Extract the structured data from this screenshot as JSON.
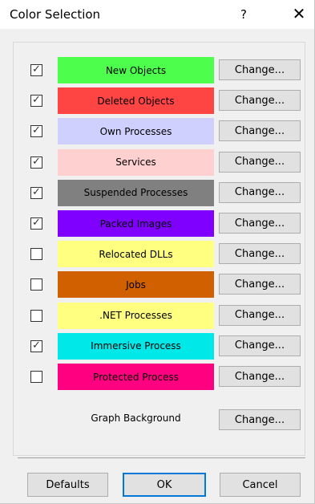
{
  "dialog": {
    "title": "Color Selection",
    "help": "?",
    "close": "✕"
  },
  "rows": [
    {
      "checked": true,
      "label": "New Objects",
      "bg": "#4dfe4d",
      "fg": "#000000"
    },
    {
      "checked": true,
      "label": "Deleted Objects",
      "bg": "#ff4444",
      "fg": "#000000"
    },
    {
      "checked": true,
      "label": "Own Processes",
      "bg": "#d0d0ff",
      "fg": "#000000"
    },
    {
      "checked": true,
      "label": "Services",
      "bg": "#ffd0d0",
      "fg": "#000000"
    },
    {
      "checked": true,
      "label": "Suspended Processes",
      "bg": "#808080",
      "fg": "#000000"
    },
    {
      "checked": true,
      "label": "Packed Images",
      "bg": "#8000ff",
      "fg": "#000000"
    },
    {
      "checked": false,
      "label": "Relocated DLLs",
      "bg": "#ffff80",
      "fg": "#000000"
    },
    {
      "checked": false,
      "label": "Jobs",
      "bg": "#d06000",
      "fg": "#000000"
    },
    {
      "checked": false,
      "label": ".NET Processes",
      "bg": "#ffff80",
      "fg": "#000000"
    },
    {
      "checked": true,
      "label": "Immersive Process",
      "bg": "#00e8e8",
      "fg": "#000000"
    },
    {
      "checked": false,
      "label": "Protected Process",
      "bg": "#ff0080",
      "fg": "#000000"
    }
  ],
  "change_label": "Change...",
  "graph_background_label": "Graph Background",
  "footer": {
    "defaults": "Defaults",
    "ok": "OK",
    "cancel": "Cancel"
  },
  "colors": {
    "ok_focus_border": "#0078d7",
    "button_bg": "#e1e1e1",
    "dialog_bg": "#f0f0f0"
  }
}
